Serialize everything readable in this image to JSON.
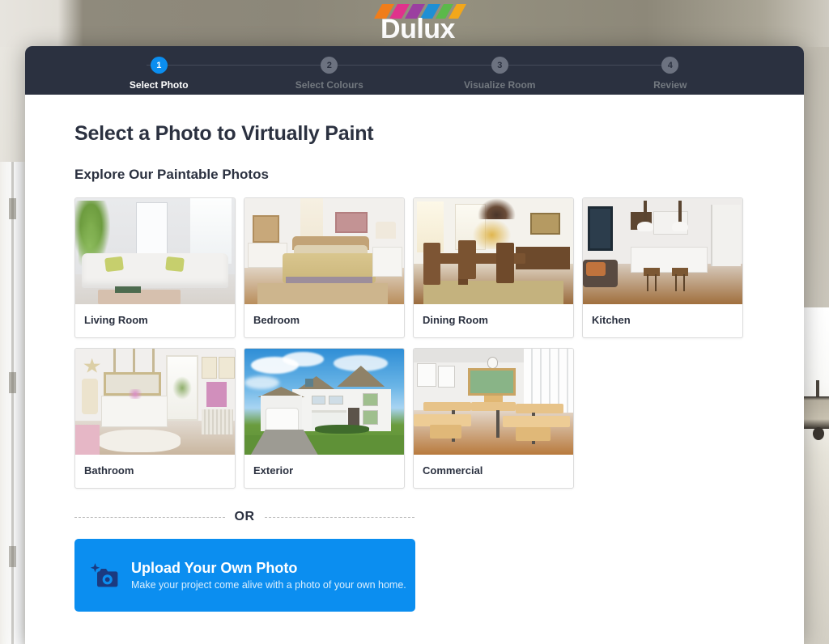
{
  "brand": {
    "name": "Dulux",
    "logo_colors": [
      "#f07d1a",
      "#e0328c",
      "#9b3fa0",
      "#1f8fd4",
      "#5bb94a",
      "#f2a71b"
    ],
    "accent": "#0b8ef0",
    "header_bg": "#2b3140"
  },
  "stepper": {
    "steps": [
      {
        "number": "1",
        "label": "Select Photo",
        "state": "active"
      },
      {
        "number": "2",
        "label": "Select Colours",
        "state": "inactive"
      },
      {
        "number": "3",
        "label": "Visualize Room",
        "state": "inactive"
      },
      {
        "number": "4",
        "label": "Review",
        "state": "inactive"
      }
    ]
  },
  "main": {
    "page_title": "Select a Photo to Virtually Paint",
    "section_title": "Explore Our Paintable Photos",
    "photos": [
      {
        "label": "Living Room",
        "thumb_class": "t-living"
      },
      {
        "label": "Bedroom",
        "thumb_class": "t-bed"
      },
      {
        "label": "Dining Room",
        "thumb_class": "t-dining"
      },
      {
        "label": "Kitchen",
        "thumb_class": "t-kitchen"
      },
      {
        "label": "Bathroom",
        "thumb_class": "t-bath"
      },
      {
        "label": "Exterior",
        "thumb_class": "t-ext"
      },
      {
        "label": "Commercial",
        "thumb_class": "t-com"
      }
    ],
    "divider_text": "OR",
    "upload": {
      "icon": "camera-plus-icon",
      "title": "Upload Your Own Photo",
      "subtitle": "Make your project come alive with a photo of your own home.",
      "background": "#0b8ef0"
    }
  }
}
